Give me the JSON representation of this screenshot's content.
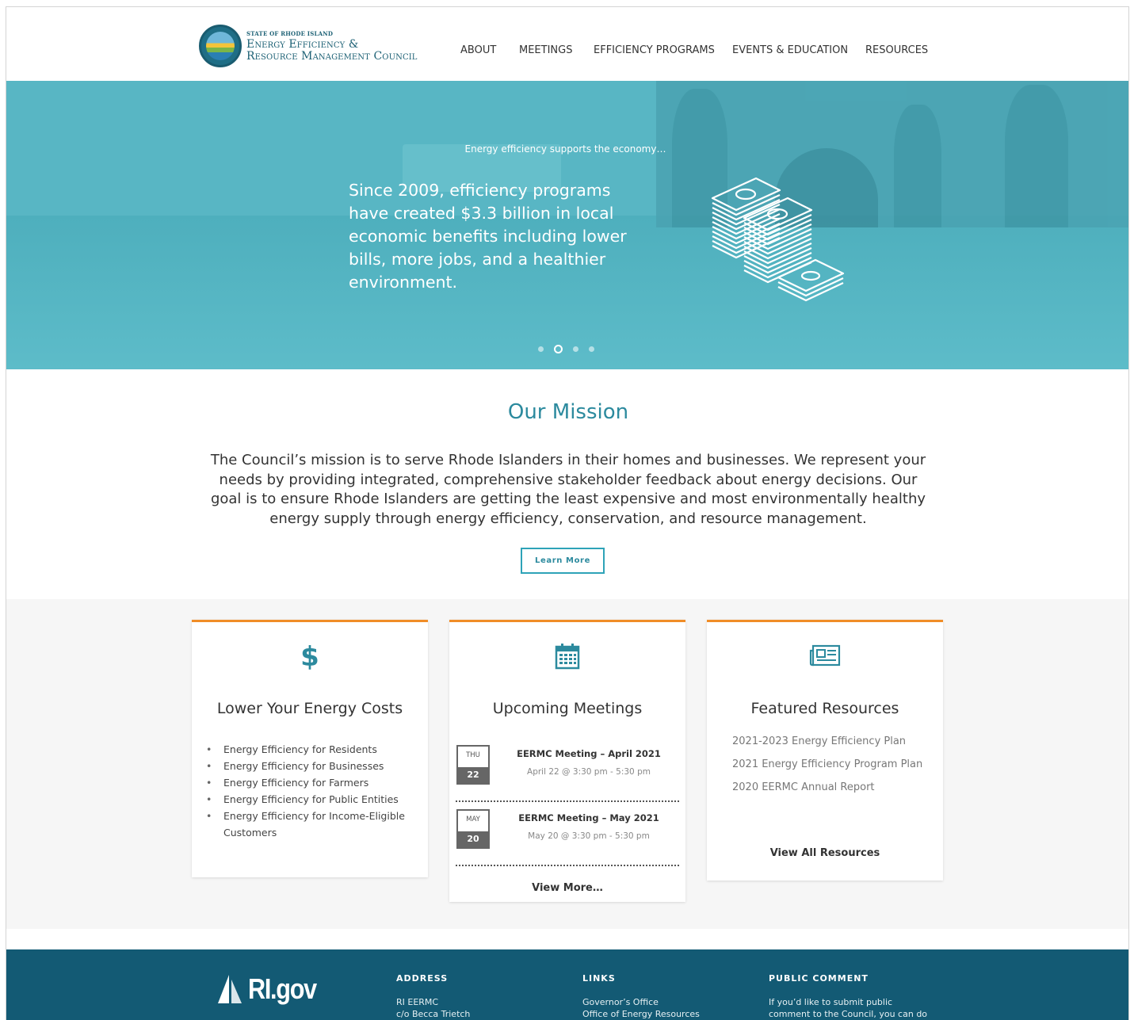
{
  "header": {
    "logo_small": "STATE OF RHODE ISLAND",
    "logo_line1": "Energy Efficiency &",
    "logo_line2": "Resource Management Council",
    "nav": [
      "ABOUT",
      "MEETINGS",
      "EFFICIENCY PROGRAMS",
      "EVENTS & EDUCATION",
      "RESOURCES"
    ]
  },
  "hero": {
    "kicker": "Energy efficiency supports the economy…",
    "text": "Since 2009, efficiency programs have created $3.3 billion in local economic benefits including lower bills, more jobs, and a healthier environment.",
    "slide_count": 4,
    "active_slide": 2
  },
  "mission": {
    "title": "Our Mission",
    "body": "The Council’s mission is to serve Rhode Islanders in their homes and businesses. We represent your needs by providing integrated, comprehensive stakeholder feedback about energy decisions. Our goal is to ensure Rhode Islanders are getting the least expensive and most environmentally healthy energy supply through energy efficiency, conservation, and resource management.",
    "button": "Learn More"
  },
  "cards": {
    "costs": {
      "icon": "dollar-icon",
      "title": "Lower Your Energy Costs",
      "items": [
        "Energy Efficiency for Residents",
        "Energy Efficiency for Businesses",
        "Energy Efficiency for Farmers",
        "Energy Efficiency for Public Entities",
        "Energy Efficiency for Income-Eligible Customers"
      ]
    },
    "meetings": {
      "icon": "calendar-icon",
      "title": "Upcoming Meetings",
      "items": [
        {
          "dow": "THU",
          "day": "22",
          "title": "EERMC Meeting – April 2021",
          "time": "April 22 @ 3:30 pm - 5:30 pm"
        },
        {
          "dow": "MAY",
          "day": "20",
          "title": "EERMC Meeting – May 2021",
          "time": "May 20 @ 3:30 pm - 5:30 pm"
        }
      ],
      "view_more": "View More…"
    },
    "resources": {
      "icon": "newspaper-icon",
      "title": "Featured Resources",
      "items": [
        "2021-2023 Energy Efficiency Plan",
        "2021 Energy Efficiency Program Plan",
        "2020 EERMC Annual Report"
      ],
      "view_all": "View All Resources"
    }
  },
  "footer": {
    "logo": "RI.gov",
    "address": {
      "heading": "ADDRESS",
      "lines": [
        "RI EERMC",
        "c/o Becca Trietch"
      ]
    },
    "links": {
      "heading": "LINKS",
      "lines": [
        "Governor’s Office",
        "Office of Energy Resources"
      ]
    },
    "public_comment": {
      "heading": "PUBLIC COMMENT",
      "lines": [
        "If you’d like to submit public",
        "comment to the Council, you can do"
      ]
    }
  },
  "colors": {
    "accent_teal": "#2c8a9e",
    "hero_bg": "#58b6c4",
    "card_top_border": "#f08d27",
    "footer_bg": "#135a74"
  }
}
